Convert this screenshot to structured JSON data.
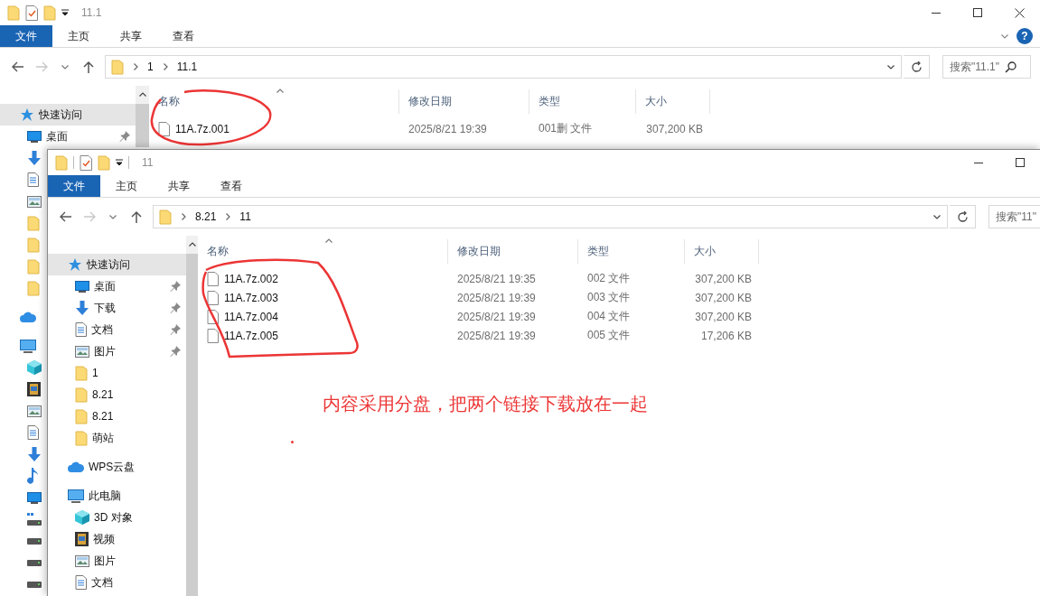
{
  "back_window": {
    "title": "11.1",
    "ribbon_tabs": [
      {
        "label": "文件",
        "selected": true
      },
      {
        "label": "主页",
        "selected": false
      },
      {
        "label": "共享",
        "selected": false
      },
      {
        "label": "查看",
        "selected": false
      }
    ],
    "help": "?",
    "nav": {
      "forward_enabled": false
    },
    "path": [
      "1",
      "11.1"
    ],
    "search": {
      "placeholder": "搜索\"11.1\""
    },
    "sidebar": [
      {
        "kind": "star",
        "label": "快速访问",
        "selected": true,
        "children": [
          {
            "kind": "desktop",
            "label": "桌面",
            "pinned": true,
            "selected": false
          },
          {
            "kind": "download",
            "selected": false
          },
          {
            "kind": "document",
            "selected": false
          },
          {
            "kind": "picture",
            "selected": false
          },
          {
            "kind": "folder",
            "selected": false
          },
          {
            "kind": "folder",
            "selected": false
          },
          {
            "kind": "folder",
            "selected": false
          },
          {
            "kind": "folder",
            "selected": false
          }
        ]
      },
      {
        "kind": "cloud",
        "selected": false
      },
      {
        "kind": "pc",
        "selected": false,
        "children": [
          {
            "kind": "cube",
            "selected": false
          },
          {
            "kind": "video",
            "selected": false
          },
          {
            "kind": "picture",
            "selected": false
          },
          {
            "kind": "document",
            "selected": false
          },
          {
            "kind": "download",
            "selected": false
          },
          {
            "kind": "music",
            "selected": false
          },
          {
            "kind": "desktop",
            "selected": false
          },
          {
            "kind": "system-drive",
            "selected": false
          },
          {
            "kind": "drive",
            "selected": false
          },
          {
            "kind": "drive",
            "selected": false
          },
          {
            "kind": "drive",
            "selected": false
          }
        ]
      }
    ],
    "columns": [
      "名称",
      "修改日期",
      "类型",
      "大小"
    ],
    "rows": [
      {
        "name": "11A.7z.001",
        "date": "2025/8/21 19:39",
        "type": "001删 文件",
        "size": "307,200 KB"
      }
    ]
  },
  "front_window": {
    "title": "11",
    "ribbon_tabs": [
      {
        "label": "文件",
        "selected": true
      },
      {
        "label": "主页",
        "selected": false
      },
      {
        "label": "共享",
        "selected": false
      },
      {
        "label": "查看",
        "selected": false
      }
    ],
    "nav": {
      "forward_enabled": false
    },
    "path": [
      "8.21",
      "11"
    ],
    "search": {
      "placeholder": "搜索\"11\""
    },
    "sidebar": [
      {
        "kind": "star",
        "label": "快速访问",
        "selected": true,
        "children": [
          {
            "kind": "desktop",
            "label": "桌面",
            "pinned": true,
            "selected": false
          },
          {
            "kind": "download",
            "label": "下载",
            "pinned": true,
            "selected": false
          },
          {
            "kind": "document",
            "label": "文档",
            "pinned": true,
            "selected": false
          },
          {
            "kind": "picture",
            "label": "图片",
            "pinned": true,
            "selected": false
          },
          {
            "kind": "folder",
            "label": "1",
            "pinned": false,
            "selected": false
          },
          {
            "kind": "folder",
            "label": "8.21",
            "pinned": false,
            "selected": false
          },
          {
            "kind": "folder",
            "label": "8.21",
            "pinned": false,
            "selected": false
          },
          {
            "kind": "folder",
            "label": "萌站",
            "pinned": false,
            "selected": false
          }
        ]
      },
      {
        "kind": "cloud",
        "label": "WPS云盘",
        "selected": false
      },
      {
        "kind": "pc",
        "label": "此电脑",
        "selected": false,
        "children": [
          {
            "kind": "cube",
            "label": "3D 对象",
            "selected": false
          },
          {
            "kind": "video",
            "label": "视频",
            "selected": false
          },
          {
            "kind": "picture",
            "label": "图片",
            "selected": false
          },
          {
            "kind": "document",
            "label": "文档",
            "selected": false
          }
        ]
      }
    ],
    "columns": [
      "名称",
      "修改日期",
      "类型",
      "大小"
    ],
    "rows": [
      {
        "name": "11A.7z.002",
        "date": "2025/8/21 19:35",
        "type": "002 文件",
        "size": "307,200 KB"
      },
      {
        "name": "11A.7z.003",
        "date": "2025/8/21 19:39",
        "type": "003 文件",
        "size": "307,200 KB"
      },
      {
        "name": "11A.7z.004",
        "date": "2025/8/21 19:39",
        "type": "004 文件",
        "size": "307,200 KB"
      },
      {
        "name": "11A.7z.005",
        "date": "2025/8/21 19:39",
        "type": "005 文件",
        "size": "17,206 KB"
      }
    ]
  },
  "annotation": {
    "note": "内容采用分盘，把两个链接下载放在一起"
  }
}
